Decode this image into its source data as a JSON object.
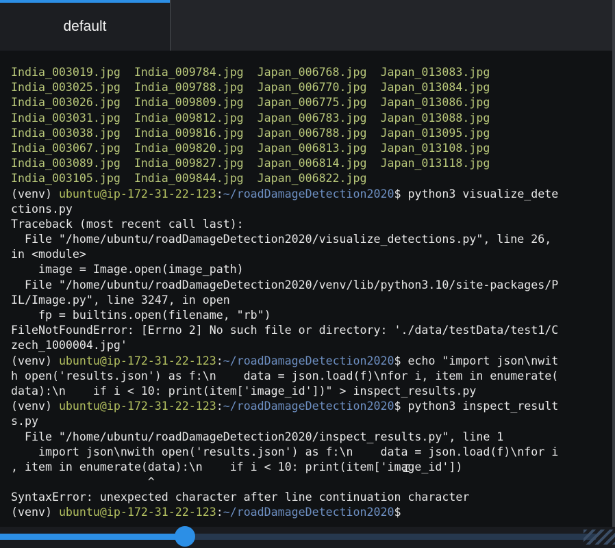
{
  "tab": {
    "label": "default"
  },
  "colors": {
    "accent": "#2c8fe6",
    "file_listing": "#b9c87a",
    "prompt_user": "#b3c060",
    "prompt_path": "#6d8fc2",
    "text": "#e8e8e8",
    "background": "#101214"
  },
  "file_listing": [
    [
      "India_003019.jpg",
      "India_009784.jpg",
      "Japan_006768.jpg",
      "Japan_013083.jpg"
    ],
    [
      "India_003025.jpg",
      "India_009788.jpg",
      "Japan_006770.jpg",
      "Japan_013084.jpg"
    ],
    [
      "India_003026.jpg",
      "India_009809.jpg",
      "Japan_006775.jpg",
      "Japan_013086.jpg"
    ],
    [
      "India_003031.jpg",
      "India_009812.jpg",
      "Japan_006783.jpg",
      "Japan_013088.jpg"
    ],
    [
      "India_003038.jpg",
      "India_009816.jpg",
      "Japan_006788.jpg",
      "Japan_013095.jpg"
    ],
    [
      "India_003067.jpg",
      "India_009820.jpg",
      "Japan_006813.jpg",
      "Japan_013108.jpg"
    ],
    [
      "India_003089.jpg",
      "India_009827.jpg",
      "Japan_006814.jpg",
      "Japan_013118.jpg"
    ],
    [
      "India_003105.jpg",
      "India_009844.jpg",
      "Japan_006822.jpg",
      ""
    ]
  ],
  "prompt": {
    "venv": "(venv) ",
    "user_host": "ubuntu@ip-172-31-22-123",
    "colon": ":",
    "path": "~/roadDamageDetection2020",
    "dollar": "$"
  },
  "session": [
    {
      "type": "prompt",
      "command": " python3 visualize_dete"
    },
    {
      "type": "text",
      "text": "ctions.py"
    },
    {
      "type": "text",
      "text": "Traceback (most recent call last):"
    },
    {
      "type": "text",
      "text": "  File \"/home/ubuntu/roadDamageDetection2020/visualize_detections.py\", line 26,"
    },
    {
      "type": "text",
      "text": "in <module>"
    },
    {
      "type": "text",
      "text": "    image = Image.open(image_path)"
    },
    {
      "type": "text",
      "text": "  File \"/home/ubuntu/roadDamageDetection2020/venv/lib/python3.10/site-packages/P"
    },
    {
      "type": "text",
      "text": "IL/Image.py\", line 3247, in open"
    },
    {
      "type": "text",
      "text": "    fp = builtins.open(filename, \"rb\")"
    },
    {
      "type": "text",
      "text": "FileNotFoundError: [Errno 2] No such file or directory: './data/testData/test1/C"
    },
    {
      "type": "text",
      "text": "zech_1000004.jpg'"
    },
    {
      "type": "prompt",
      "command": " echo \"import json\\nwit"
    },
    {
      "type": "text",
      "text": "h open('results.json') as f:\\n    data = json.load(f)\\nfor i, item in enumerate("
    },
    {
      "type": "text",
      "text": "data):\\n    if i < 10: print(item['image_id'])\" > inspect_results.py"
    },
    {
      "type": "prompt",
      "command": " python3 inspect_result"
    },
    {
      "type": "text",
      "text": "s.py"
    },
    {
      "type": "text",
      "text": "  File \"/home/ubuntu/roadDamageDetection2020/inspect_results.py\", line 1"
    },
    {
      "type": "text",
      "text": "    import json\\nwith open('results.json') as f:\\n    data = json.load(f)\\nfor i"
    },
    {
      "type": "text",
      "text": ", item in enumerate(data):\\n    if i < 10: print(item['image_id'])"
    },
    {
      "type": "text",
      "text": "                    ^"
    },
    {
      "type": "text",
      "text": "SyntaxError: unexpected character after line continuation character"
    },
    {
      "type": "prompt",
      "command": ""
    }
  ],
  "playback": {
    "progress": 0.31
  }
}
